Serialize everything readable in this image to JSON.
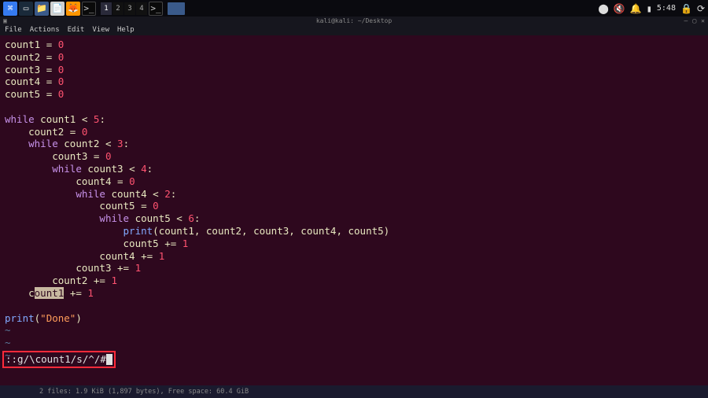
{
  "taskbar": {
    "workspaces": [
      "1",
      "2",
      "3",
      "4"
    ],
    "active_workspace": 0,
    "clock": "5:48"
  },
  "window": {
    "title": "kali@kali: ~/Desktop"
  },
  "menubar": {
    "items": [
      "File",
      "Actions",
      "Edit",
      "View",
      "Help"
    ]
  },
  "code": {
    "lines": [
      {
        "t": "assign",
        "lhs": "count1",
        "rhs": "0"
      },
      {
        "t": "assign",
        "lhs": "count2",
        "rhs": "0"
      },
      {
        "t": "assign",
        "lhs": "count3",
        "rhs": "0"
      },
      {
        "t": "assign",
        "lhs": "count4",
        "rhs": "0"
      },
      {
        "t": "assign",
        "lhs": "count5",
        "rhs": "0"
      },
      {
        "t": "blank"
      },
      {
        "t": "while",
        "indent": 0,
        "var": "count1",
        "cmp": "<",
        "val": "5"
      },
      {
        "t": "assign",
        "indent": 1,
        "lhs": "count2",
        "rhs": "0"
      },
      {
        "t": "while",
        "indent": 1,
        "var": "count2",
        "cmp": "<",
        "val": "3"
      },
      {
        "t": "assign",
        "indent": 2,
        "lhs": "count3",
        "rhs": "0"
      },
      {
        "t": "while",
        "indent": 2,
        "var": "count3",
        "cmp": "<",
        "val": "4"
      },
      {
        "t": "assign",
        "indent": 3,
        "lhs": "count4",
        "rhs": "0"
      },
      {
        "t": "while",
        "indent": 3,
        "var": "count4",
        "cmp": "<",
        "val": "2"
      },
      {
        "t": "assign",
        "indent": 4,
        "lhs": "count5",
        "rhs": "0"
      },
      {
        "t": "while",
        "indent": 4,
        "var": "count5",
        "cmp": "<",
        "val": "6"
      },
      {
        "t": "print",
        "indent": 5,
        "args": "count1, count2, count3, count4, count5"
      },
      {
        "t": "aug",
        "indent": 5,
        "lhs": "count5",
        "rhs": "1"
      },
      {
        "t": "aug",
        "indent": 4,
        "lhs": "count4",
        "rhs": "1"
      },
      {
        "t": "aug",
        "indent": 3,
        "lhs": "count3",
        "rhs": "1"
      },
      {
        "t": "aug",
        "indent": 2,
        "lhs": "count2",
        "rhs": "1"
      },
      {
        "t": "aug",
        "indent": 1,
        "lhs": "count1",
        "rhs": "1",
        "hl": "ount1"
      },
      {
        "t": "blank"
      },
      {
        "t": "printstr",
        "val": "\"Done\""
      },
      {
        "t": "tilde"
      },
      {
        "t": "tilde"
      },
      {
        "t": "tilde"
      }
    ]
  },
  "cmdline": {
    "text": "::g/\\count1/s/^/#"
  },
  "statusbar": {
    "text": "2 files: 1.9 KiB (1,897 bytes), Free space: 60.4 GiB"
  },
  "icons": {
    "kali": "⌘",
    "screen": "▭",
    "folder": "📁",
    "paper": "📄",
    "firefox": "🦊",
    "term": ">_",
    "rec": "⬤",
    "mute": "🔇",
    "bell": "🔔",
    "battery": "▮",
    "lock": "🔒",
    "power": "⟳",
    "minimize": "—",
    "close": "✕"
  }
}
